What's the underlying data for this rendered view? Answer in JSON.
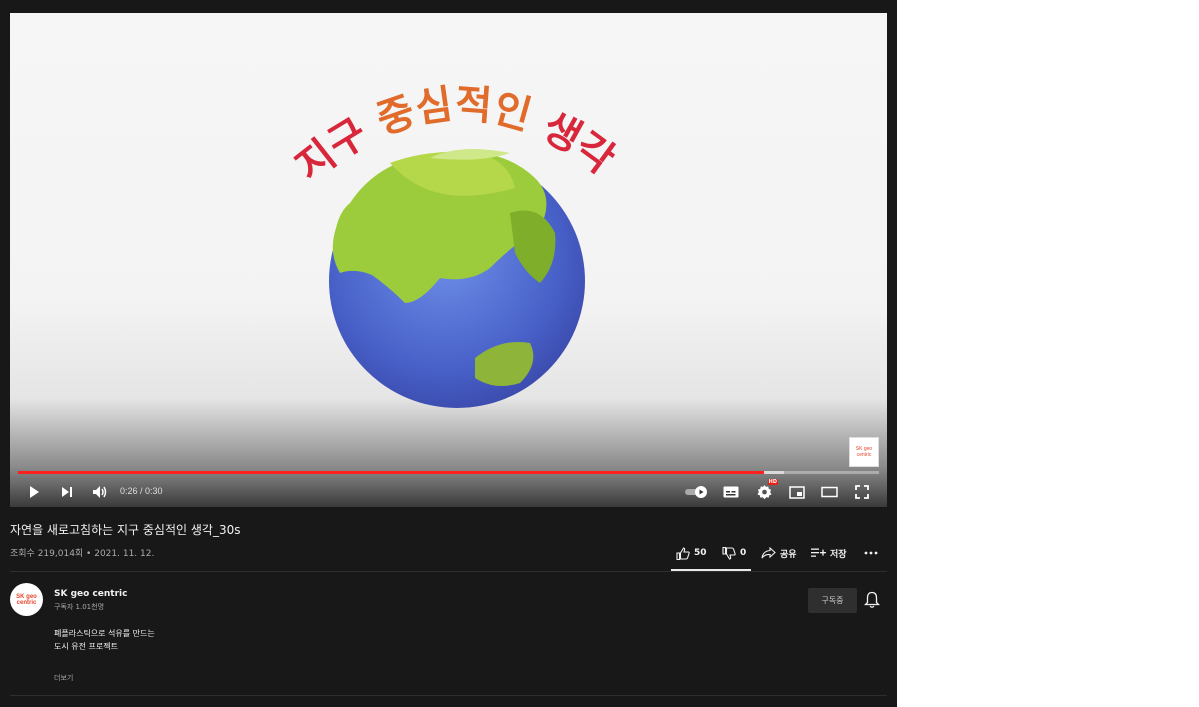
{
  "video": {
    "overlay_title": "지구 중심적인 생각",
    "watermark": "SK geo centric",
    "time_display": "0:26 / 0:30",
    "progress_fraction": 0.8667,
    "buffered_fraction": 0.89,
    "controls": {
      "play_icon": "play-icon",
      "next_icon": "next-icon",
      "volume_icon": "volume-icon",
      "autoplay_icon": "autoplay-toggle-icon",
      "captions_icon": "captions-icon",
      "settings_icon": "settings-icon",
      "hd_badge": "HD",
      "miniplayer_icon": "miniplayer-icon",
      "theater_icon": "theater-icon",
      "fullscreen_icon": "fullscreen-icon"
    }
  },
  "info": {
    "title": "자연을 새로고침하는 지구 중심적인 생각_30s",
    "meta": "조회수 219,014회 • 2021. 11. 12.",
    "likes": "50",
    "dislikes": "0",
    "share_label": "공유",
    "save_label": "저장"
  },
  "channel": {
    "name": "SK geo centric",
    "subscribers": "구독자 1.01천명",
    "subscribe_label": "구독중",
    "description_line1": "폐플라스틱으로 석유를 만드는",
    "description_line2": "도시 유전 프로젝트",
    "more_label": "더보기"
  },
  "colors": {
    "background": "#181818",
    "progress": "#ff2020",
    "title_red": "#d8263a",
    "title_orange": "#e06b2a"
  }
}
